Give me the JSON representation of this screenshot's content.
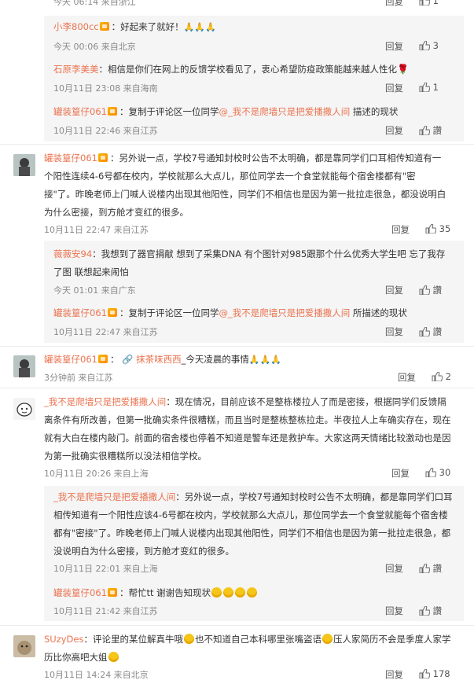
{
  "top_partial": {
    "meta": "今天 06:14 来自浙江",
    "reply": "回复",
    "likes": "1"
  },
  "thread1": {
    "r1": {
      "name": "小李800cc",
      "text": "：好起来了就好！",
      "emoji": "🙏🙏🙏",
      "meta": "今天 00:06 来自北京",
      "reply": "回复",
      "likes": "3"
    },
    "r2": {
      "name": "石原李美美",
      "text": "：相信是你们在网上的反馈学校看见了，衷心希望防疫政策能越来越人性化",
      "emoji": "🌹",
      "meta": "10月11日 23:08 来自海南",
      "reply": "回复",
      "likes": "1"
    },
    "r3": {
      "name": "罐装篁仔061",
      "text": "：复制于评论区一位同学",
      "at": "@_我不是爬墙只是把爱播撒人间",
      "text2": " 描述的现状",
      "meta": "10月11日 22:46 来自江苏",
      "reply": "回复",
      "likes": "讚"
    }
  },
  "comment2": {
    "name": "罐装篁仔061",
    "text": "：另外说一点，学校7号通知封校时公告不太明确，都是靠同学们口耳相传知道有一个阳性连续4-6号都在校内，学校就那么大点儿，那位同学去一个食堂就能每个宿舍楼都有\"密接\"了。昨晚老师上门喊人说楼内出现其他阳性，同学们不相信也是因为第一批拉走很急，都没说明白为什么密接，到方舱才变红的很多。",
    "meta": "10月11日 22:47 来自江苏",
    "reply": "回复",
    "likes": "35",
    "replies": [
      {
        "name": "薇薇安94",
        "text": "：我想到了器官捐献 想到了采集DNA 有个图针对985跟那个什么优秀大学生吧 忘了我存了图 联想起来闹怕",
        "meta": "今天 01:01 来自广东",
        "reply": "回复",
        "likes": "讚"
      },
      {
        "name": "罐装篁仔061",
        "text": "：复制于评论区一位同学",
        "at": "@_我不是爬墙只是把爱播撒人间",
        "text2": " 所描述的现状",
        "meta": "10月11日 22:47 来自江苏",
        "reply": "回复",
        "likes": "讚"
      }
    ]
  },
  "comment3": {
    "name": "罐装篁仔061",
    "text": "：",
    "at": "🔗 抹茶味西西",
    "text2": "_今天凌晨的事情",
    "emoji": "🙏🙏🙏",
    "meta": "3分钟前 来自江苏",
    "reply": "回复",
    "likes": "2"
  },
  "comment4": {
    "name": "_我不是爬墙只是把爱播撒人间",
    "text": "：现在情况，目前应该不是整栋楼拉人了而是密接，根据同学们反馈隔离条件有所改善，但第一批确实条件很糟糕，而且当时是整栋整栋拉走。半夜拉人上车确实存在，现在就有大白在楼内敲门。前面的宿舍楼也停着不知道是警车还是救护车。大家这两天情绪比较激动也是因为第一批确实很糟糕所以没法相信学校。",
    "meta": "10月11日 20:26 来自上海",
    "reply": "回复",
    "likes": "30",
    "replies": [
      {
        "name": "_我不是爬墙只是把爱播撒人间",
        "text": "：另外说一点，学校7号通知封校时公告不太明确，都是靠同学们口耳相传知道有一个阳性应该4-6号都在校内，学校就那么大点儿，那位同学去一个食堂就能每个宿舍楼都有\"密接\"了。昨晚老师上门喊人说楼内出现其他阳性，同学们不相信也是因为第一批拉走很急，都没说明白为什么密接，到方舱才变红的很多。",
        "meta": "10月11日 22:01 来自上海",
        "reply": "回复",
        "likes": "讚"
      },
      {
        "name": "罐装篁仔061",
        "text": "：帮忙tt 谢谢告知现状",
        "meta": "10月11日 21:42 来自江苏",
        "reply": "回复",
        "likes": "讚"
      }
    ]
  },
  "comment5": {
    "name": "SUzyDes",
    "text": "：评论里的某位解真牛哦",
    "text2": "也不知道自己本科哪里张嘴盗语",
    "text3": "压人家简历不会是季度人家学历比你高吧大姐",
    "meta": "10月11日 14:24 来自北京",
    "reply": "回复",
    "likes": "178"
  }
}
